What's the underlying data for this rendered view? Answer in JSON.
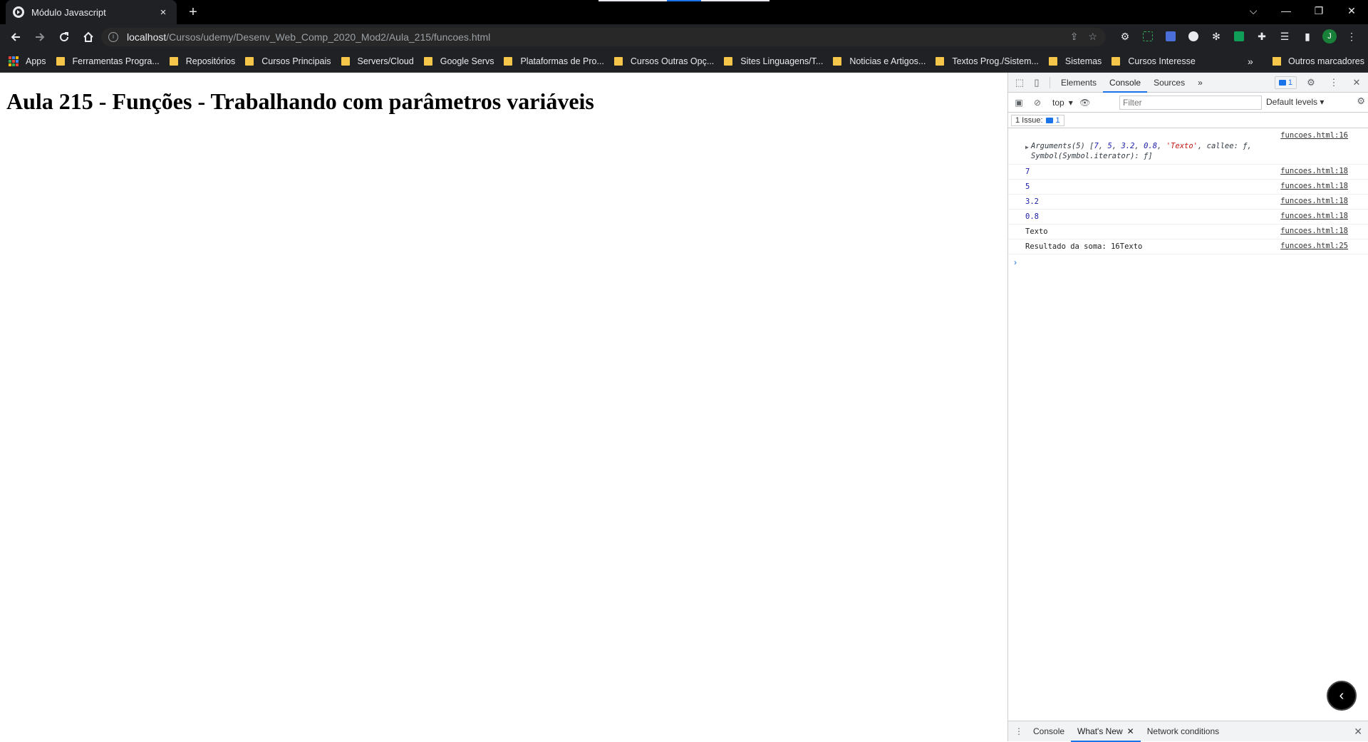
{
  "browser": {
    "tab_title": "Módulo Javascript",
    "tab_close": "×",
    "new_tab": "+",
    "url_host": "localhost",
    "url_path": "/Cursos/udemy/Desenv_Web_Comp_2020_Mod2/Aula_215/funcoes.html",
    "avatar_letter": "J",
    "window_controls": {
      "tab_search": "⌵",
      "minimize": "—",
      "restore": "❐",
      "close": "✕"
    }
  },
  "bookmarks": [
    "Ferramentas Progra...",
    "Repositórios",
    "Cursos Principais",
    "Servers/Cloud",
    "Google Servs",
    "Plataformas de Pro...",
    "Cursos Outras Opç...",
    "Sites Linguagens/T...",
    "Noticias e Artigos...",
    "Textos Prog./Sistem...",
    "Sistemas",
    "Cursos Interesse"
  ],
  "bookmarks_apps": "Apps",
  "bookmarks_more": "»",
  "bookmarks_other": "Outros marcadores",
  "page": {
    "heading": "Aula 215 - Funções - Trabalhando com parâmetros variáveis"
  },
  "devtools": {
    "tabs": [
      "Elements",
      "Console",
      "Sources"
    ],
    "active_tab": "Console",
    "more_tabs": "»",
    "issue_count": "1",
    "context": "top",
    "filter_placeholder": "Filter",
    "levels": "Default levels",
    "issues_label": "1 Issue:",
    "issues_count": "1",
    "logs": [
      {
        "type": "args",
        "source": "funcoes.html:16",
        "prefix": "Arguments(5) [",
        "n1": "7",
        "n2": "5",
        "n3": "3.2",
        "n4": "0.8",
        "str": "'Texto'",
        "suffix": ", callee: ƒ, Symbol(Symbol.iterator): ƒ]"
      },
      {
        "type": "num",
        "value": "7",
        "source": "funcoes.html:18"
      },
      {
        "type": "num",
        "value": "5",
        "source": "funcoes.html:18"
      },
      {
        "type": "num",
        "value": "3.2",
        "source": "funcoes.html:18"
      },
      {
        "type": "num",
        "value": "0.8",
        "source": "funcoes.html:18"
      },
      {
        "type": "text",
        "value": "Texto",
        "source": "funcoes.html:18"
      },
      {
        "type": "text",
        "value": "Resultado da soma: 16Texto",
        "source": "funcoes.html:25"
      }
    ],
    "prompt": "›",
    "drawer_tabs": [
      "Console",
      "What's New",
      "Network conditions"
    ],
    "drawer_active": "What's New"
  }
}
